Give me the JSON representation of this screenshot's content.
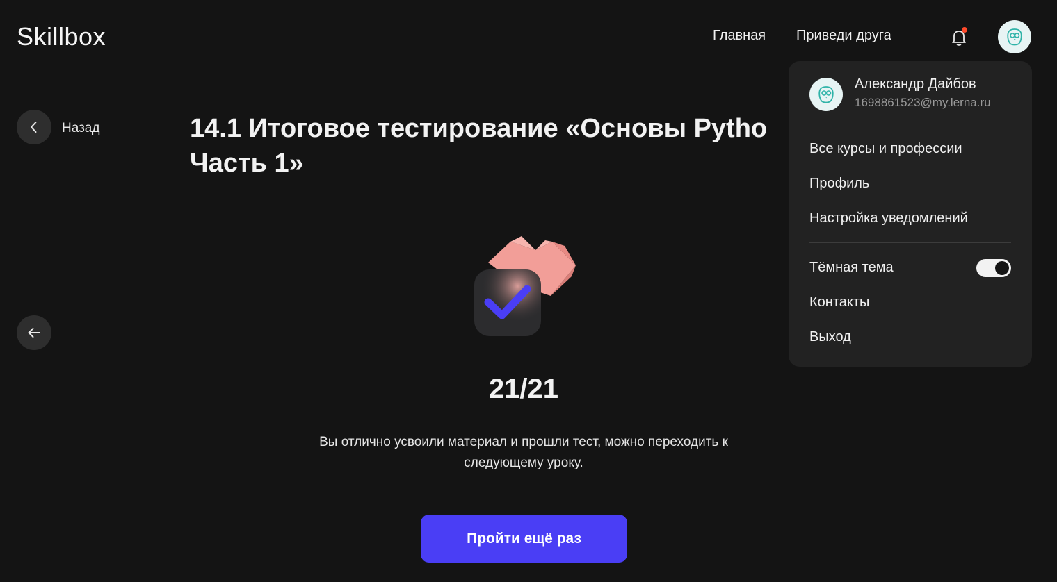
{
  "header": {
    "logo": "Skillbox",
    "nav": [
      "Главная",
      "Приведи друга"
    ],
    "bell_icon": "bell-icon",
    "notification_dot_color": "#ff4a2b",
    "avatar_icon": "owl-avatar-icon"
  },
  "page": {
    "back_label": "Назад",
    "title_line1": "14.1 Итоговое тестирование «Основы Pytho",
    "title_line2": "Часть 1»",
    "score": "21/21",
    "description": "Вы отлично усвоили материал и прошли тест, можно переходить к следующему уроку.",
    "retry_button": "Пройти ещё раз"
  },
  "dropdown": {
    "user_name": "Александр Дайбов",
    "user_email": "1698861523@my.lerna.ru",
    "items": [
      "Все курсы и профессии",
      "Профиль",
      "Настройка уведомлений"
    ],
    "dark_theme_label": "Тёмная тема",
    "dark_theme_on": true,
    "bottom_items": [
      "Контакты",
      "Выход"
    ]
  },
  "colors": {
    "background": "#141414",
    "accent": "#4a3ef5",
    "dropdown_bg": "#222222"
  }
}
